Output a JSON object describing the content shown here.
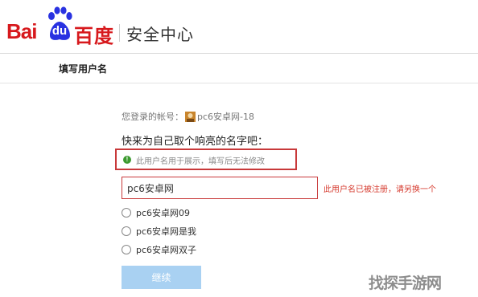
{
  "header": {
    "logo": {
      "bai": "Bai",
      "du": "du",
      "cn": "百度"
    },
    "section": "安全中心"
  },
  "page": {
    "subtitle": "填写用户名"
  },
  "account": {
    "label": "您登录的帐号：",
    "name": "pc6安卓网-18"
  },
  "form": {
    "prompt": "快来为自己取个响亮的名字吧：",
    "hint": "此用户名用于展示，填写后无法修改",
    "input_value": "pc6安卓网",
    "error": "此用户名已被注册，请另换一个",
    "suggestions": [
      "pc6安卓网09",
      "pc6安卓网是我",
      "pc6安卓网双子"
    ],
    "continue_label": "继续"
  },
  "watermark": "找探手游网",
  "colors": {
    "brand_red": "#d7191d",
    "paw_blue": "#2932e1",
    "error_red": "#c8393a",
    "button_blue": "#a9d1f2"
  }
}
